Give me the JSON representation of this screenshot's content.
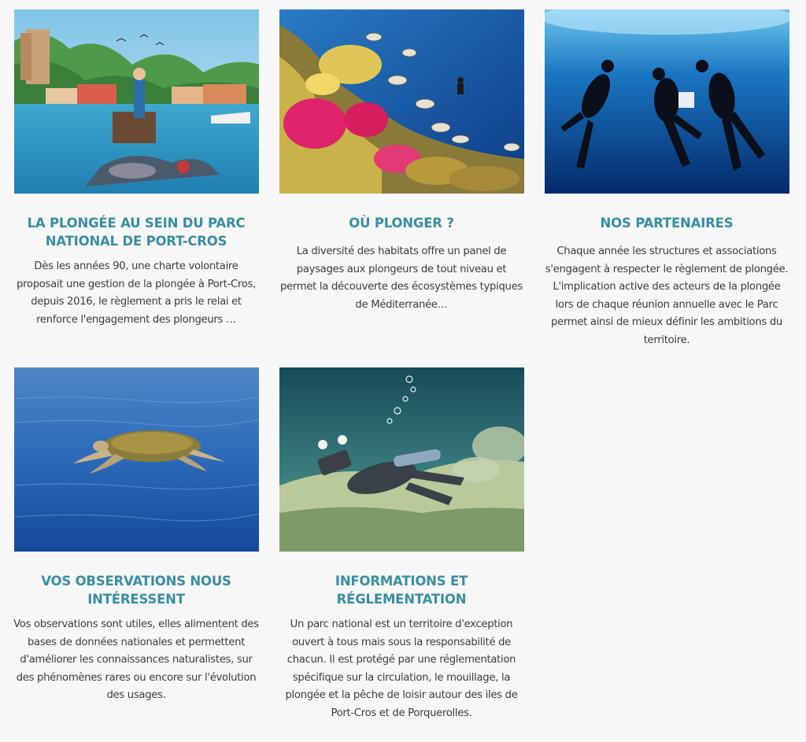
{
  "cards": [
    {
      "title": "LA PLONGÉE AU SEIN DU PARC NATIONAL DE PORT-CROS",
      "text": "Dès les années 90, une charte volontaire proposait une gestion de la plongée à Port-Cros, depuis 2016, le règlement a pris le relai et renforce l'engagement des plongeurs …"
    },
    {
      "title": "OÙ PLONGER ?",
      "text": "La diversité des habitats offre un panel de paysages aux plongeurs de tout niveau et permet la découverte des écosystèmes typiques de Méditerranée…"
    },
    {
      "title": "NOS PARTENAIRES",
      "text": "Chaque année les structures et associations s'engagent à respecter le règlement de plongée. L'implication active des acteurs de la plongée lors de chaque réunion annuelle avec le Parc permet ainsi de mieux définir les ambitions du territoire."
    },
    {
      "title": "VOS OBSERVATIONS NOUS INTÉRESSENT",
      "text": "Vos observations sont utiles, elles alimentent des bases de données nationales et permettent d'améliorer les connaissances naturalistes, sur des phénomènes rares ou encore sur l'évolution des usages."
    },
    {
      "title": "INFORMATIONS ET RÉGLEMENTATION",
      "text": "Un parc national est un territoire d'exception ouvert à tous mais sous la responsabilité de chacun. Il est protégé par une réglementation spécifique sur la circulation, le mouillage, la plongée et la pêche de loisir autour des iles de Port-Cros et de Porquerolles."
    }
  ],
  "colors": {
    "accent": "#3a8ea3",
    "text": "#3d3d3d",
    "background": "#f7f7f7"
  }
}
